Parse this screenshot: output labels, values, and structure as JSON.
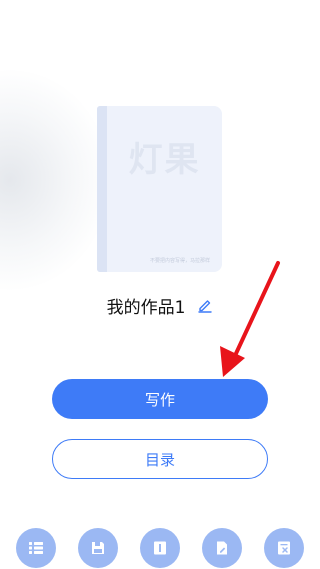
{
  "cover": {
    "title": "灯果",
    "note": "不要把内容写得，马拉那样"
  },
  "work": {
    "title": "我的作品1",
    "edit_icon": "pencil-icon"
  },
  "actions": {
    "write_label": "写作",
    "catalog_label": "目录"
  },
  "toolbar": {
    "icons": [
      "list-icon",
      "save-icon",
      "book-icon",
      "edit-document-icon",
      "delete-document-icon"
    ]
  },
  "colors": {
    "accent": "#3e7bf7",
    "toolbar_button": "#9bb8f3",
    "cover_bg": "#eef2fb",
    "annotation_arrow": "#e8141b"
  }
}
